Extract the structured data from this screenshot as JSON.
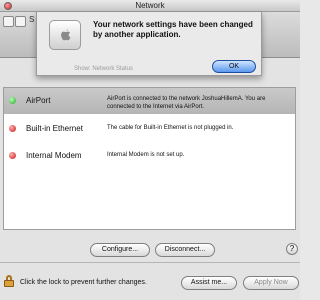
{
  "window": {
    "title": "Network"
  },
  "toolbar": {
    "show_prefix": "S"
  },
  "dialog": {
    "message": "Your network settings have been changed by another application.",
    "ok_label": "OK",
    "behind_text": "Show: Network Status"
  },
  "services": [
    {
      "name": "AirPort",
      "status": "green",
      "description": "AirPort is connected to the network JoshuaHillemA. You are connected to the Internet via AirPort."
    },
    {
      "name": "Built-in Ethernet",
      "status": "red",
      "description": "The cable for Built-in Ethernet is not plugged in."
    },
    {
      "name": "Internal Modem",
      "status": "red",
      "description": "Internal Modem is not set up."
    }
  ],
  "buttons": {
    "configure": "Configure...",
    "disconnect": "Disconnect...",
    "help": "?",
    "assist": "Assist me...",
    "apply": "Apply Now"
  },
  "lock": {
    "text": "Click the lock to prevent further changes."
  },
  "colors": {
    "status_green": "#1ea81e",
    "status_red": "#c51515",
    "default_button": "#5b99f0"
  }
}
